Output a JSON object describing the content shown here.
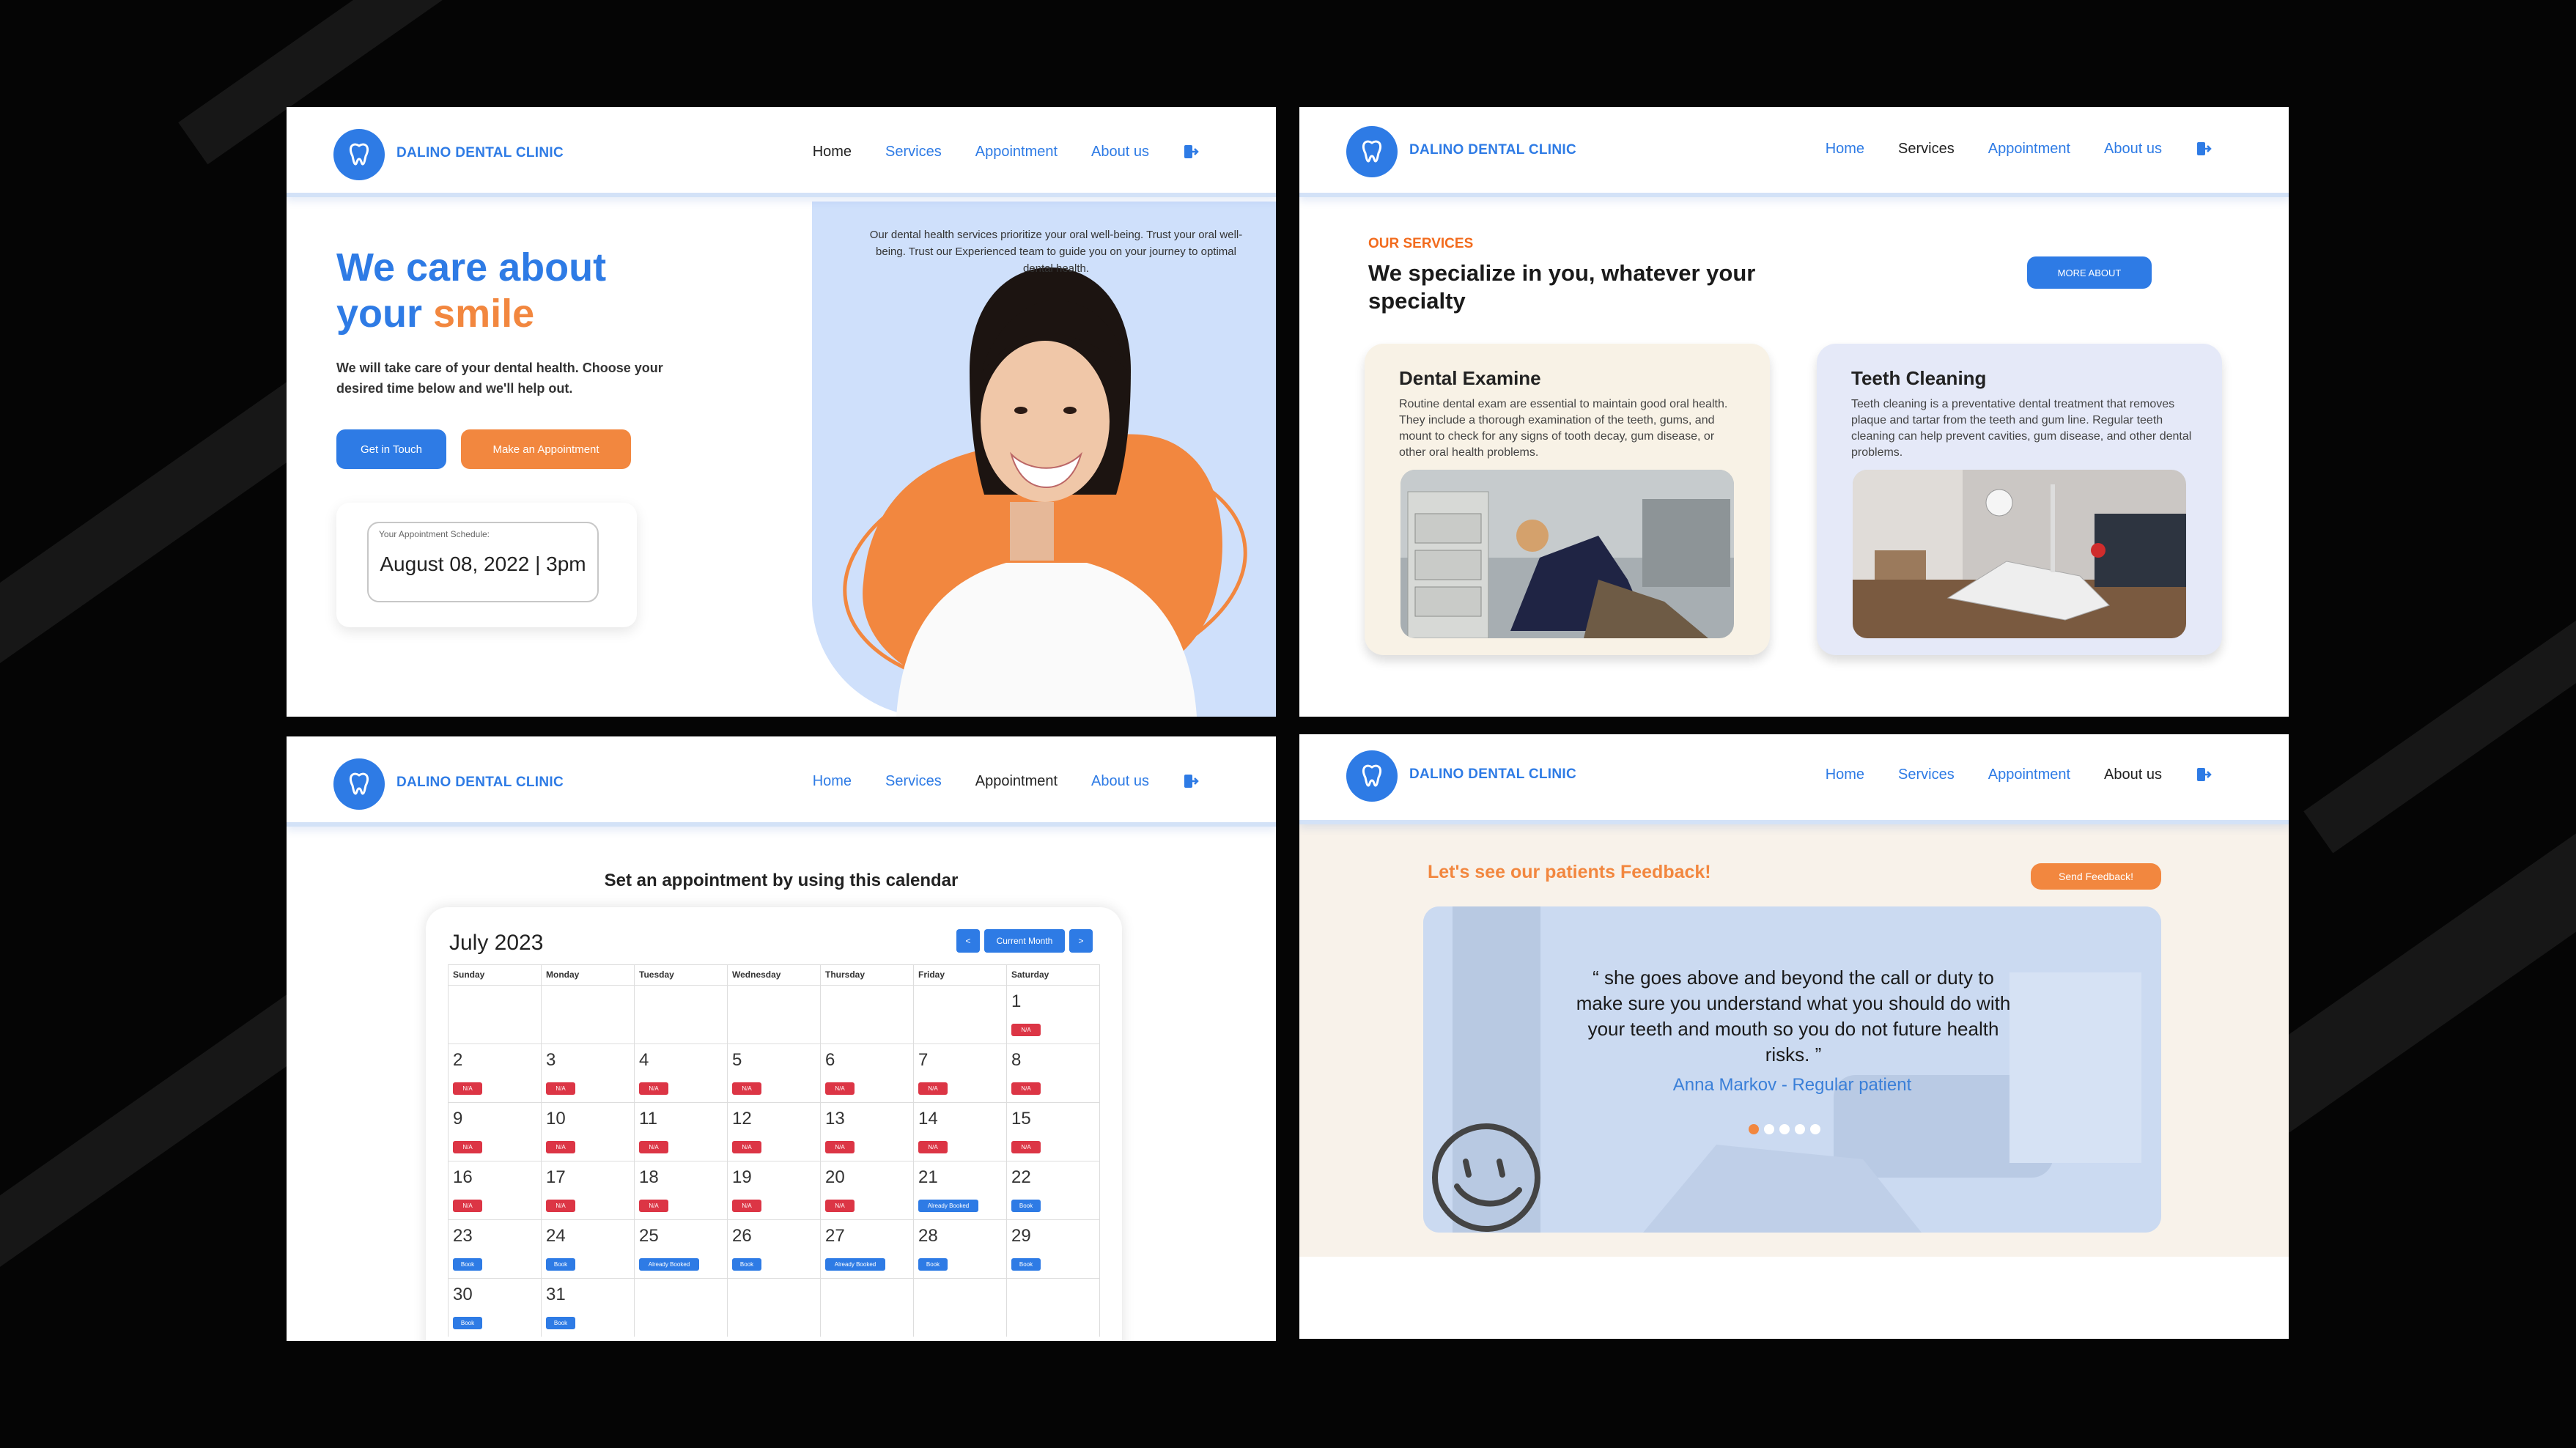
{
  "brand": {
    "name": "DALINO DENTAL CLINIC",
    "accent": "#2e7be5",
    "orange": "#f2873f"
  },
  "nav": {
    "home": "Home",
    "services": "Services",
    "appointment": "Appointment",
    "about": "About us",
    "logout_icon": "logout-icon"
  },
  "home": {
    "title_line1": "We care about",
    "title_word": "your",
    "title_highlight": "smile",
    "subtitle": "We will take care of your dental health. Choose your desired time below and we'll help out.",
    "btn_touch": "Get in Touch",
    "btn_appointment": "Make an Appointment",
    "schedule_label": "Your Appointment Schedule:",
    "schedule_value": "August 08, 2022 | 3pm",
    "description": "Our dental health services prioritize your oral well-being. Trust your oral well-being. Trust our Experienced team to guide you on your journey to optimal dental health."
  },
  "services": {
    "tag": "OUR SERVICES",
    "title": "We specialize in you, whatever your specialty",
    "more_btn": "MORE ABOUT",
    "cards": [
      {
        "title": "Dental Examine",
        "text": "Routine dental exam are essential to maintain good oral health. They include a thorough examination of the teeth, gums, and mount to check for any signs of tooth decay, gum disease, or other oral health problems."
      },
      {
        "title": "Teeth Cleaning",
        "text": "Teeth cleaning is a preventative dental treatment that removes plaque and tartar from the teeth and gum line. Regular teeth cleaning can help prevent cavities, gum disease, and other dental problems."
      }
    ]
  },
  "calendar": {
    "heading": "Set an appointment by using this calendar",
    "month": "July 2023",
    "prev": "<",
    "current": "Current Month",
    "next": ">",
    "weekdays": [
      "Sunday",
      "Monday",
      "Tuesday",
      "Wednesday",
      "Thursday",
      "Friday",
      "Saturday"
    ],
    "weeks": [
      [
        null,
        null,
        null,
        null,
        null,
        null,
        {
          "day": "1",
          "status": "N/A"
        }
      ],
      [
        {
          "day": "2",
          "status": "N/A"
        },
        {
          "day": "3",
          "status": "N/A"
        },
        {
          "day": "4",
          "status": "N/A"
        },
        {
          "day": "5",
          "status": "N/A"
        },
        {
          "day": "6",
          "status": "N/A"
        },
        {
          "day": "7",
          "status": "N/A"
        },
        {
          "day": "8",
          "status": "N/A"
        }
      ],
      [
        {
          "day": "9",
          "status": "N/A"
        },
        {
          "day": "10",
          "status": "N/A"
        },
        {
          "day": "11",
          "status": "N/A"
        },
        {
          "day": "12",
          "status": "N/A"
        },
        {
          "day": "13",
          "status": "N/A"
        },
        {
          "day": "14",
          "status": "N/A"
        },
        {
          "day": "15",
          "status": "N/A"
        }
      ],
      [
        {
          "day": "16",
          "status": "N/A"
        },
        {
          "day": "17",
          "status": "N/A"
        },
        {
          "day": "18",
          "status": "N/A"
        },
        {
          "day": "19",
          "status": "N/A"
        },
        {
          "day": "20",
          "status": "N/A"
        },
        {
          "day": "21",
          "status": "Already Booked"
        },
        {
          "day": "22",
          "status": "Book"
        }
      ],
      [
        {
          "day": "23",
          "status": "Book"
        },
        {
          "day": "24",
          "status": "Book"
        },
        {
          "day": "25",
          "status": "Already Booked"
        },
        {
          "day": "26",
          "status": "Book"
        },
        {
          "day": "27",
          "status": "Already Booked"
        },
        {
          "day": "28",
          "status": "Book"
        },
        {
          "day": "29",
          "status": "Book"
        }
      ],
      [
        {
          "day": "30",
          "status": "Book"
        },
        {
          "day": "31",
          "status": "Book"
        },
        null,
        null,
        null,
        null,
        null
      ]
    ]
  },
  "feedback": {
    "title": "Let's see our patients Feedback!",
    "send_btn": "Send Feedback!",
    "quote": "“ she goes above and beyond the call or duty to make sure you understand what you should do with your teeth and mouth so you do not future health risks. ”",
    "author": "Anna Markov  - Regular patient",
    "slides": 5,
    "active_slide": 1
  }
}
